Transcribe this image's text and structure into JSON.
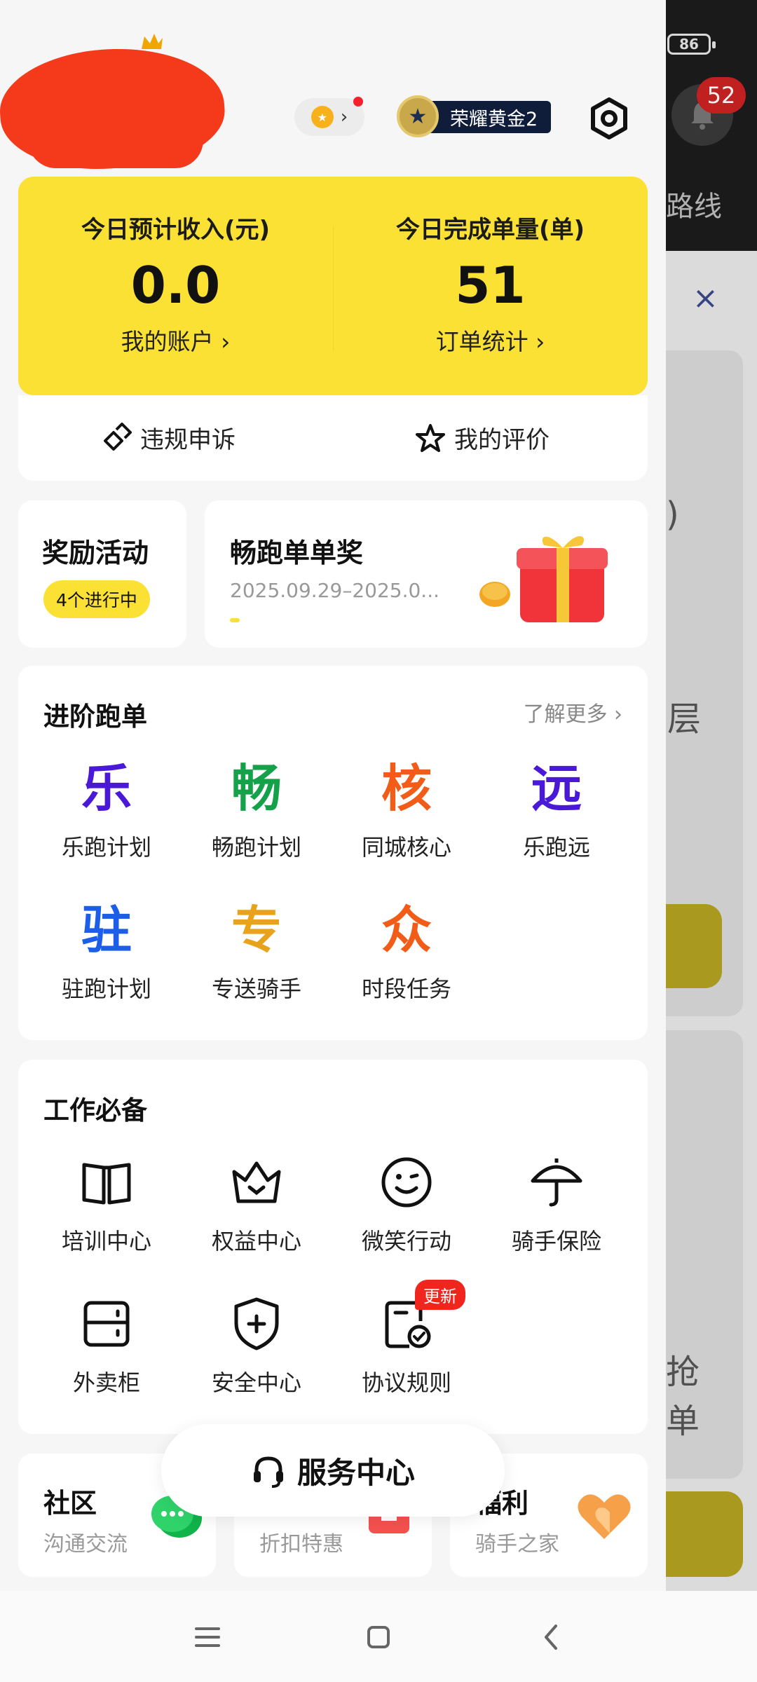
{
  "status_bar": {
    "battery": "86"
  },
  "background": {
    "bell_badge": "52",
    "route_label": "路线",
    "close_symbol": "×",
    "text_1": ")",
    "text_2": "层",
    "text_3": "抢",
    "text_4": "单"
  },
  "header": {
    "rank_label": "荣耀黄金2"
  },
  "income": {
    "left": {
      "title": "今日预计收入(元)",
      "value": "0.0",
      "link": "我的账户 ›"
    },
    "right": {
      "title": "今日完成单量(单)",
      "value": "51",
      "link": "订单统计 ›"
    }
  },
  "actions": {
    "appeal": "违规申诉",
    "rating": "我的评价"
  },
  "reward": {
    "title": "奖励活动",
    "pill": "4个进行中"
  },
  "promo": {
    "title": "畅跑单单奖",
    "date": "2025.09.29–2025.0..."
  },
  "advanced": {
    "title": "进阶跑单",
    "more": "了解更多 ›",
    "items": [
      {
        "glyph": "乐",
        "label": "乐跑计划",
        "color": "#4a19d8"
      },
      {
        "glyph": "畅",
        "label": "畅跑计划",
        "color": "#14a14a"
      },
      {
        "glyph": "核",
        "label": "同城核心",
        "color": "#f25c19"
      },
      {
        "glyph": "远",
        "label": "乐跑远",
        "color": "#4a19d8"
      },
      {
        "glyph": "驻",
        "label": "驻跑计划",
        "color": "#1d5ee8"
      },
      {
        "glyph": "专",
        "label": "专送骑手",
        "color": "#e9a21b"
      },
      {
        "glyph": "众",
        "label": "时段任务",
        "color": "#f25c19"
      }
    ]
  },
  "work": {
    "title": "工作必备",
    "items": [
      {
        "label": "培训中心",
        "icon": "book-icon"
      },
      {
        "label": "权益中心",
        "icon": "crown-icon"
      },
      {
        "label": "微笑行动",
        "icon": "smile-icon"
      },
      {
        "label": "骑手保险",
        "icon": "umbrella-icon"
      },
      {
        "label": "外卖柜",
        "icon": "locker-icon"
      },
      {
        "label": "安全中心",
        "icon": "shield-icon"
      },
      {
        "label": "协议规则",
        "icon": "agreement-icon"
      }
    ],
    "new_tag": "更新"
  },
  "bottom_cards": {
    "community": {
      "title": "社区",
      "sub": "沟通交流"
    },
    "discount": {
      "sub": "折扣特惠"
    },
    "welfare": {
      "title": "福利",
      "sub": "骑手之家"
    }
  },
  "service": {
    "label": "服务中心"
  }
}
